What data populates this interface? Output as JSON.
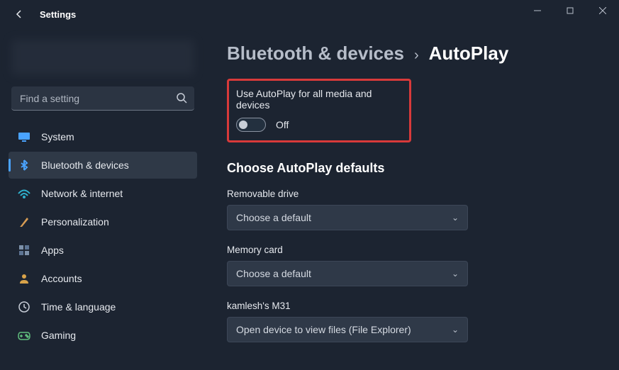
{
  "window": {
    "title": "Settings"
  },
  "search": {
    "placeholder": "Find a setting"
  },
  "sidebar": {
    "items": [
      {
        "label": "System",
        "iconColor": "#4aa3ff"
      },
      {
        "label": "Bluetooth & devices",
        "iconColor": "#4aa3ff"
      },
      {
        "label": "Network & internet",
        "iconColor": "#2fb2cf"
      },
      {
        "label": "Personalization",
        "iconColor": "#d79c54"
      },
      {
        "label": "Apps",
        "iconColor": "#6f86a1"
      },
      {
        "label": "Accounts",
        "iconColor": "#d9a34a"
      },
      {
        "label": "Time & language",
        "iconColor": "#9aa4b2"
      },
      {
        "label": "Gaming",
        "iconColor": "#4bb36c"
      }
    ],
    "selectedIndex": 1
  },
  "breadcrumb": {
    "parent": "Bluetooth & devices",
    "current": "AutoPlay"
  },
  "autoplay_toggle": {
    "label": "Use AutoPlay for all media and devices",
    "state": "Off",
    "value": false
  },
  "defaults": {
    "section_title": "Choose AutoPlay defaults",
    "items": [
      {
        "label": "Removable drive",
        "value": "Choose a default"
      },
      {
        "label": "Memory card",
        "value": "Choose a default"
      },
      {
        "label": "kamlesh's M31",
        "value": "Open device to view files (File Explorer)"
      }
    ]
  }
}
